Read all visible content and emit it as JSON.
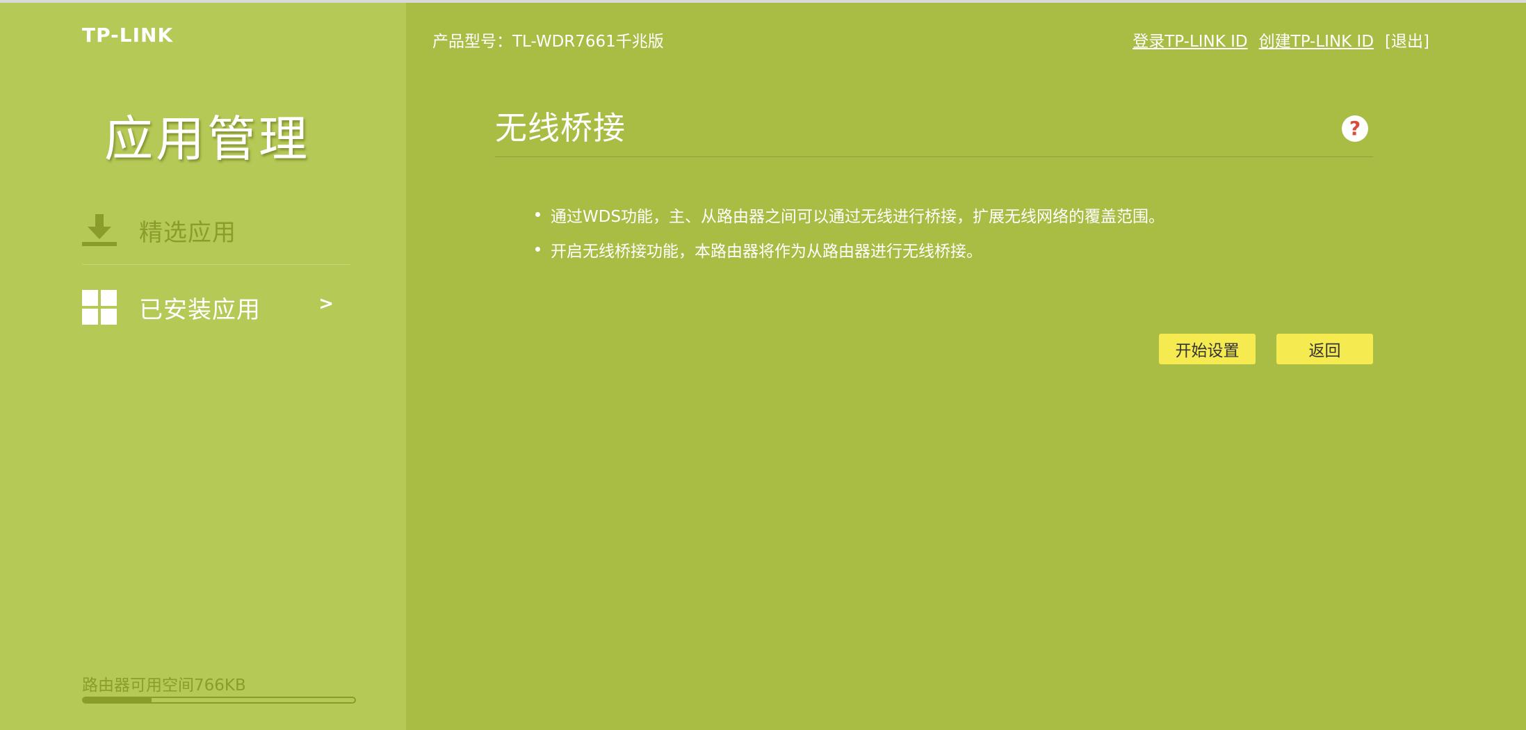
{
  "brand": {
    "logo_text": "TP-LINK"
  },
  "header": {
    "model_label": "产品型号：TL-WDR7661千兆版",
    "login_link": "登录TP-LINK ID",
    "create_link": "创建TP-LINK ID",
    "logout": "[退出]"
  },
  "sidebar": {
    "title": "应用管理",
    "items": [
      {
        "label": "精选应用",
        "icon": "download-icon",
        "active": false
      },
      {
        "label": "已安装应用",
        "icon": "grid-icon",
        "active": true,
        "chevron": ">"
      }
    ],
    "storage": {
      "text": "路由器可用空间766KB",
      "used_fraction": 0.25
    }
  },
  "main": {
    "title": "无线桥接",
    "help_icon": "question-icon",
    "bullets": [
      "通过WDS功能，主、从路由器之间可以通过无线进行桥接，扩展无线网络的覆盖范围。",
      "开启无线桥接功能，本路由器将作为从路由器进行无线桥接。"
    ],
    "buttons": {
      "start": "开始设置",
      "back": "返回"
    }
  },
  "colors": {
    "main_bg": "#a9bd45",
    "sidebar_bg": "#b5c957",
    "button_bg": "#f5eb50",
    "help_q": "#d94c3a"
  }
}
